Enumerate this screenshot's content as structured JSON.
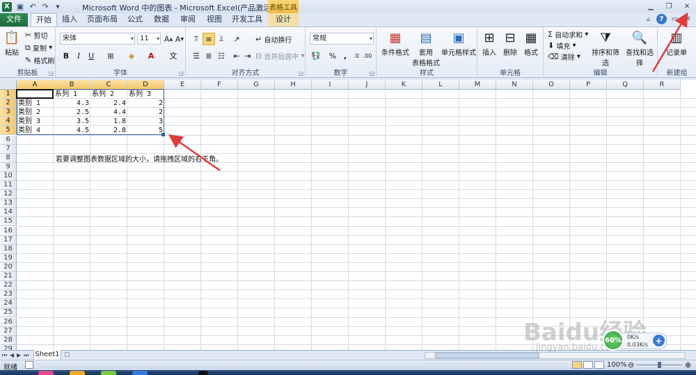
{
  "window": {
    "title": "Microsoft Word 中的图表 - Microsoft Excel(产品激活失败)",
    "context_tab_group": "表格工具"
  },
  "tabs": [
    "文件",
    "开始",
    "插入",
    "页面布局",
    "公式",
    "数据",
    "审阅",
    "视图",
    "开发工具",
    "设计"
  ],
  "ribbon": {
    "clipboard": {
      "paste": "粘贴",
      "cut": "剪切",
      "copy": "复制",
      "format_painter": "格式刷",
      "label": "剪贴板"
    },
    "font": {
      "name": "宋体",
      "size": "11",
      "label": "字体",
      "bold": "B",
      "italic": "I",
      "underline": "U"
    },
    "alignment": {
      "wrap": "自动换行",
      "merge": "合并后居中",
      "label": "对齐方式"
    },
    "number": {
      "format": "常规",
      "percent": "%",
      "comma": ",",
      "label": "数字"
    },
    "styles": {
      "conditional": "条件格式",
      "table": "套用",
      "table2": "表格格式",
      "cell_styles": "单元格样式",
      "label": "样式"
    },
    "cells": {
      "insert": "插入",
      "delete": "删除",
      "format": "格式",
      "label": "单元格"
    },
    "editing": {
      "autosum": "自动求和",
      "fill": "填充",
      "clear": "清除",
      "sort": "排序和筛选",
      "find": "查找和选择",
      "label": "编辑"
    },
    "new_group": {
      "record": "记录单",
      "label": "新建组"
    }
  },
  "columns": [
    "A",
    "B",
    "C",
    "D",
    "E",
    "F",
    "G",
    "H",
    "I",
    "J",
    "K",
    "L",
    "M",
    "N",
    "O",
    "P",
    "Q",
    "R"
  ],
  "rows": [
    "1",
    "2",
    "3",
    "4",
    "5",
    "6",
    "7",
    "8",
    "9",
    "10",
    "11",
    "12",
    "13",
    "14",
    "15",
    "16",
    "17",
    "18",
    "19",
    "20",
    "21",
    "22",
    "23",
    "24",
    "25",
    "26",
    "27",
    "28",
    "29"
  ],
  "table": {
    "header": [
      "",
      "系列 1",
      "系列 2",
      "系列 3"
    ],
    "data": [
      [
        "类别 1",
        "4.3",
        "2.4",
        "2"
      ],
      [
        "类别 2",
        "2.5",
        "4.4",
        "2"
      ],
      [
        "类别 3",
        "3.5",
        "1.8",
        "3"
      ],
      [
        "类别 4",
        "4.5",
        "2.8",
        "5"
      ]
    ]
  },
  "note": "若要调整图表数据区域的大小，请拖拽区域的右下角。",
  "sheet_tab": "Sheet1",
  "status": {
    "ready": "就绪",
    "zoom": "100%"
  },
  "net_widget": {
    "percent": "60%",
    "up": "0K/s",
    "down": "0.03K/s"
  },
  "watermark": {
    "main": "Baidu经验",
    "sub": "jingyan.baidu.com"
  },
  "accent_colors": {
    "file_tab": "#217346",
    "selection": "#375f9c",
    "arrow": "#e03a3a",
    "header_selected": "#f4c56a"
  }
}
